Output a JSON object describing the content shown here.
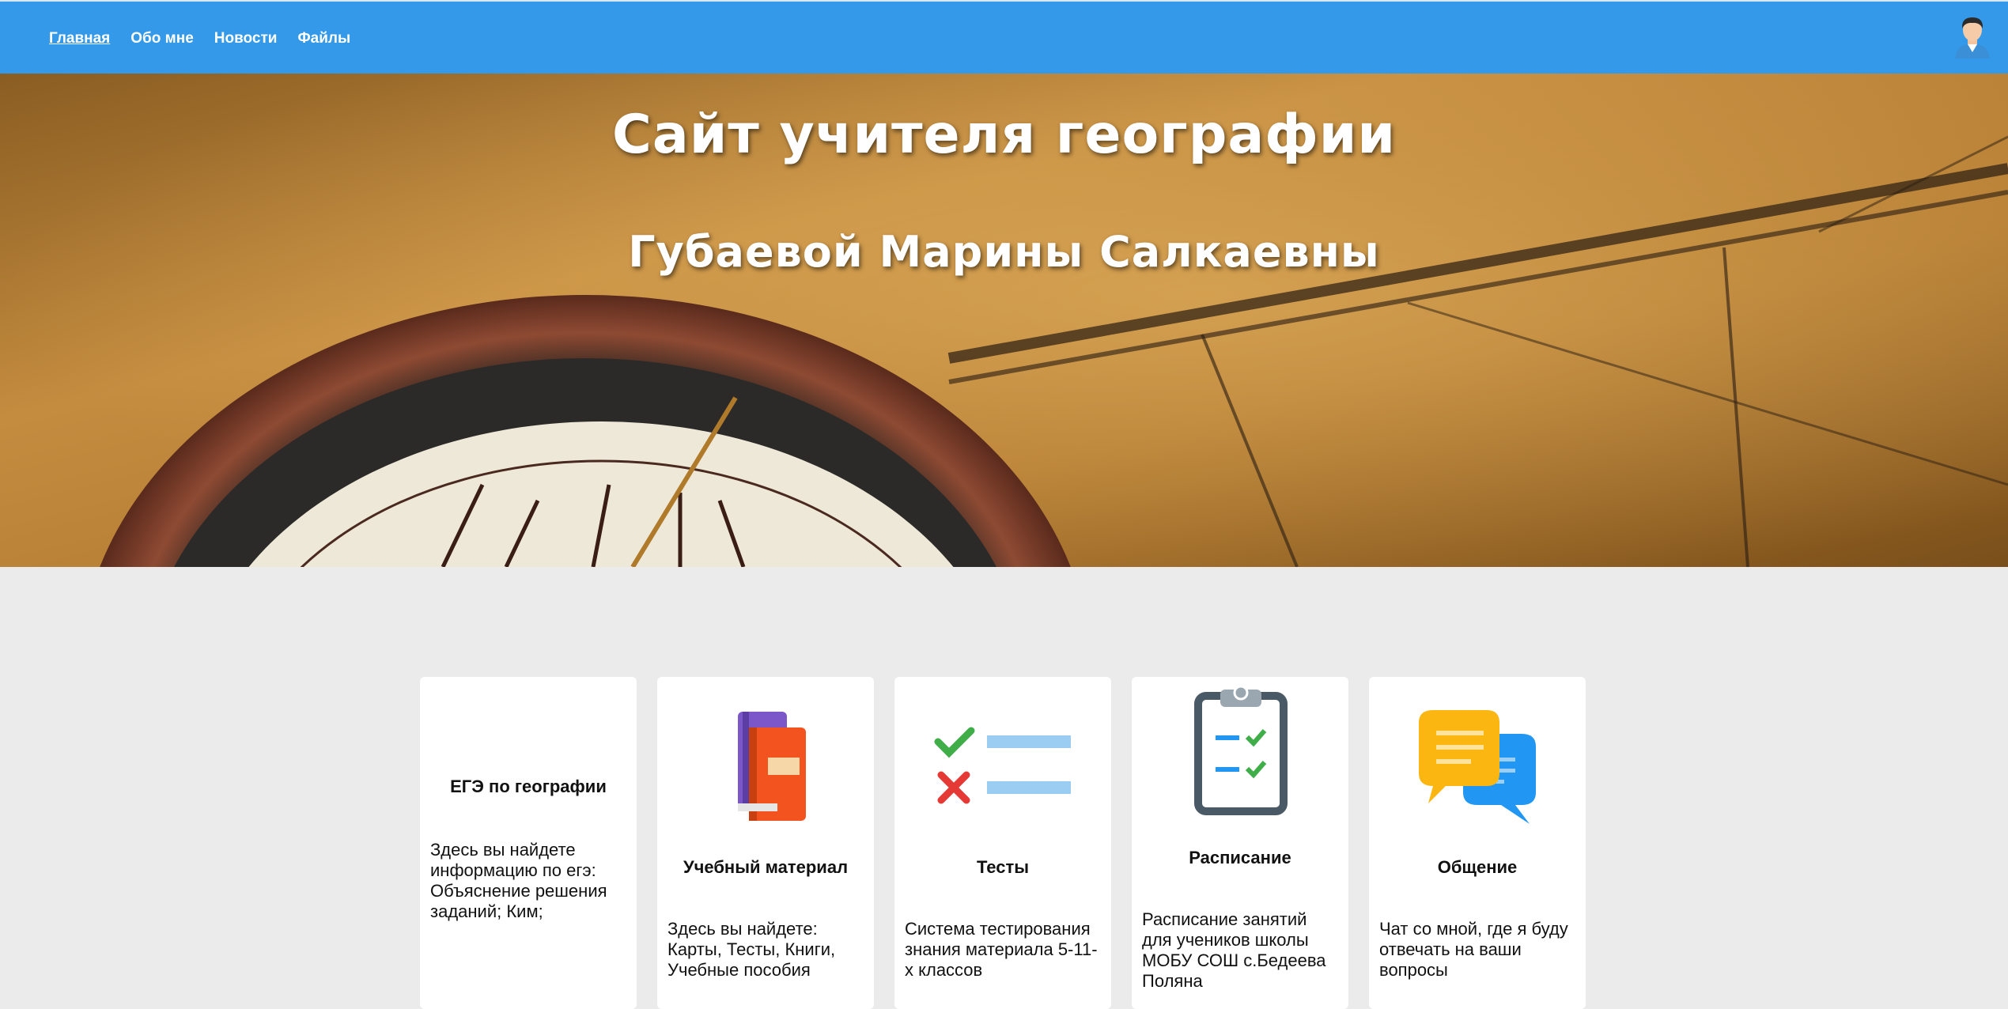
{
  "nav": {
    "items": [
      {
        "label": "Главная",
        "active": true
      },
      {
        "label": "Обо мне"
      },
      {
        "label": "Новости"
      },
      {
        "label": "Файлы"
      }
    ]
  },
  "hero": {
    "title": "Сайт учителя географии",
    "subtitle": "Губаевой Марины Салкаевны"
  },
  "cards": [
    {
      "title": "ЕГЭ по географии",
      "desc": "Здесь вы найдете информацию по егэ: Объяснение решения заданий; Ким;",
      "icon": "none"
    },
    {
      "title": "Учебный материал",
      "desc": "Здесь вы найдете: Карты, Тесты, Книги, Учебные пособия",
      "icon": "books-icon"
    },
    {
      "title": "Тесты",
      "desc": "Система тестирования знания материала 5-11-х классов",
      "icon": "checklist-icon"
    },
    {
      "title": "Расписание",
      "desc": "Расписание занятий для учеников школы МОБУ СОШ с.Бедеева Поляна",
      "icon": "clipboard-icon"
    },
    {
      "title": "Общение",
      "desc": "Чат со мной, где я буду отвечать на ваши вопросы",
      "icon": "chat-bubbles-icon"
    }
  ],
  "colors": {
    "topbar": "#3399e8",
    "page_bg": "#ebebeb",
    "card_bg": "#ffffff"
  }
}
